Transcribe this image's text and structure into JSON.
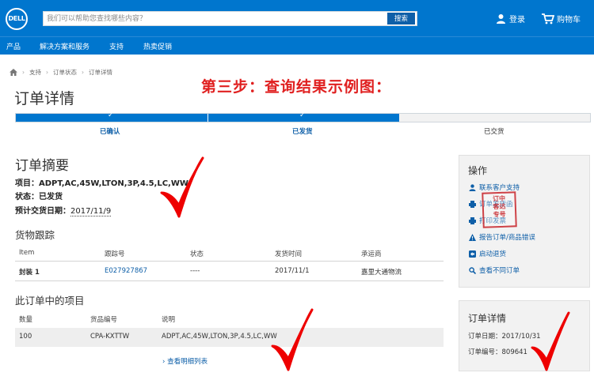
{
  "header": {
    "logo_text": "DELL",
    "search_placeholder": "我们可以帮助您查找哪些内容？",
    "search_button": "搜索",
    "login_label": "登录",
    "cart_label": "购物车",
    "nav": [
      "产品",
      "解决方案和服务",
      "支持",
      "热卖促销"
    ]
  },
  "breadcrumb": [
    "支持",
    "订单状态",
    "订单详情"
  ],
  "page_title": "订单详情",
  "annotation": "第三步：查询结果示例图：",
  "progress": {
    "completed_fraction": 0.667,
    "steps": [
      {
        "label": "已确认",
        "done": true
      },
      {
        "label": "已发货",
        "done": true
      },
      {
        "label": "已交货",
        "done": false
      }
    ]
  },
  "summary": {
    "title": "订单摘要",
    "item_key": "项目：",
    "item_value": "ADPT,AC,45W,LTON,3P,4.5,LC,WW",
    "status_key": "状态：",
    "status_value": "已发货",
    "eta_key": "预计交货日期：",
    "eta_value": "2017/11/9"
  },
  "tracking": {
    "title": "货物跟踪",
    "columns": [
      "Item",
      "跟踪号",
      "状态",
      "发货时间",
      "承运商"
    ],
    "rows": [
      {
        "item": "封装 1",
        "tracking_no": "E027927867",
        "status": "----",
        "ship_date": "2017/11/1",
        "carrier": "嘉里大通物流"
      }
    ]
  },
  "order_items": {
    "title": "此订单中的项目",
    "columns": [
      "数量",
      "货品编号",
      "说明"
    ],
    "rows": [
      {
        "qty": "100",
        "part_no": "CPA-KXTTW",
        "desc": "ADPT,AC,45W,LTON,3P,4.5,LC,WW"
      }
    ],
    "more_link": "查看明细列表"
  },
  "actions": {
    "title": "操作",
    "items": [
      {
        "label": "联系客户支持",
        "icon": "person-icon"
      },
      {
        "label": "订单发货函",
        "icon": "print-icon"
      },
      {
        "label": "打印发票",
        "icon": "print-icon"
      },
      {
        "label": "报告订单/商品错误",
        "icon": "warning-icon"
      },
      {
        "label": "启动退货",
        "icon": "return-icon"
      },
      {
        "label": "查看不同订单",
        "icon": "search-icon"
      }
    ],
    "stamp_text": "订单\n达客\n专号"
  },
  "order_detail": {
    "title": "订单详情",
    "date_key": "订单日期：",
    "date_value": "2017/10/31",
    "number_key": "订单编号：",
    "number_value": "809641"
  },
  "colors": {
    "brand_blue": "#0076ce",
    "link_blue": "#0e5fa8",
    "annotation_red": "#e02020"
  }
}
